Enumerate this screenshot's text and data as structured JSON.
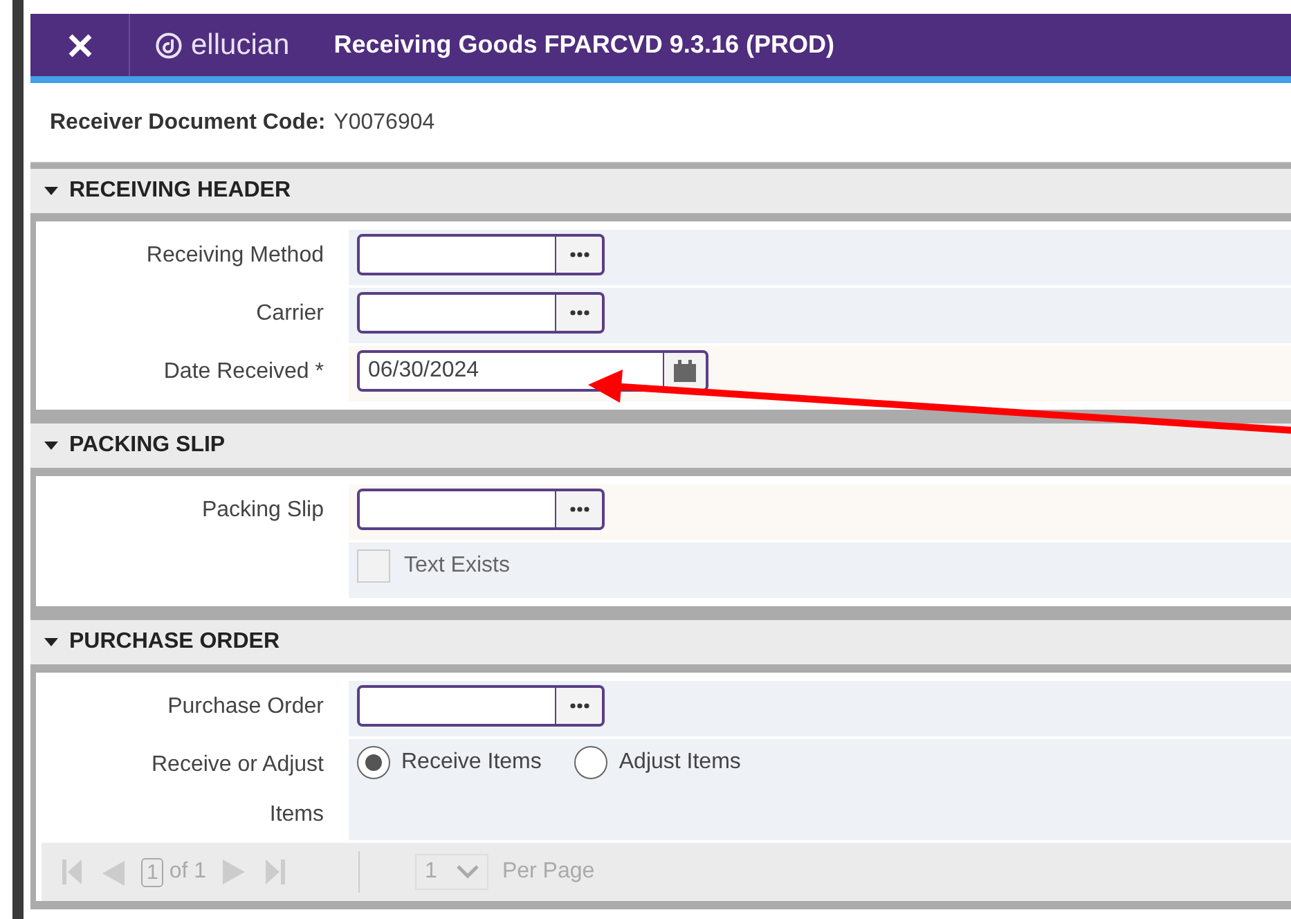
{
  "header": {
    "brand": "ellucian",
    "title": "Receiving Goods FPARCVD 9.3.16 (PROD)"
  },
  "key_block": {
    "label": "Receiver Document Code:",
    "value": "Y0076904"
  },
  "sections": [
    {
      "title": "RECEIVING HEADER",
      "expanded": true,
      "rows": [
        {
          "label": "Receiving Method",
          "kind": "lookup",
          "highlighted": false
        },
        {
          "label": "Carrier",
          "kind": "lookup",
          "highlighted": false
        },
        {
          "label": "Date Received *",
          "kind": "date",
          "value": "06/30/2024",
          "highlighted": true
        }
      ]
    },
    {
      "title": "PACKING SLIP",
      "expanded": true,
      "rows": [
        {
          "label": "Packing Slip",
          "kind": "lookup",
          "highlighted": true
        },
        {
          "kind": "checkbox",
          "text": "Text Exists",
          "checked": false,
          "highlighted": false
        }
      ]
    },
    {
      "title": "PURCHASE ORDER",
      "expanded": true,
      "rows": [
        {
          "label": "Purchase Order",
          "kind": "lookup",
          "highlighted": false
        },
        {
          "label": "Receive or Adjust Items",
          "kind": "radio",
          "highlighted": false,
          "options": [
            {
              "label": "Receive Items",
              "selected": true
            },
            {
              "label": "Adjust Items",
              "selected": false
            }
          ]
        }
      ],
      "pager": {
        "page": "1",
        "of_text": "of 1",
        "per_page": "1",
        "per_page_label": "Per Page"
      }
    }
  ]
}
